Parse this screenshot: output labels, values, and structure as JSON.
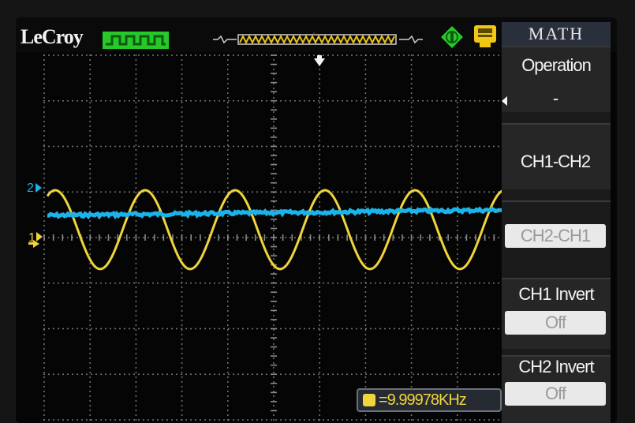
{
  "header": {
    "brand": "LeCroy",
    "status_icon": "acquisition-status-indicator",
    "trigger_bar_icon": "trigger-position-bar",
    "trigger_marker_label": "T",
    "run_icon": "run-status-icon",
    "storage_icon": "storage-icon"
  },
  "channels": {
    "ch1": {
      "marker": "1",
      "color": "#f0d43c"
    },
    "ch2": {
      "marker": "2",
      "color": "#1ab4ea"
    },
    "trigger_level_icon": "trigger-level-arrow"
  },
  "menu": {
    "title": "MATH",
    "operation_label": "Operation",
    "operation_value": "-",
    "option_1": "CH1-CH2",
    "option_2": "CH2-CH1",
    "ch1_invert_label": "CH1 Invert",
    "ch1_invert_value": "Off",
    "ch2_invert_label": "CH2 Invert",
    "ch2_invert_value": "Off"
  },
  "measurement": {
    "frequency": "=9.99978KHz",
    "icon": "channel-1-measurement-icon"
  }
}
